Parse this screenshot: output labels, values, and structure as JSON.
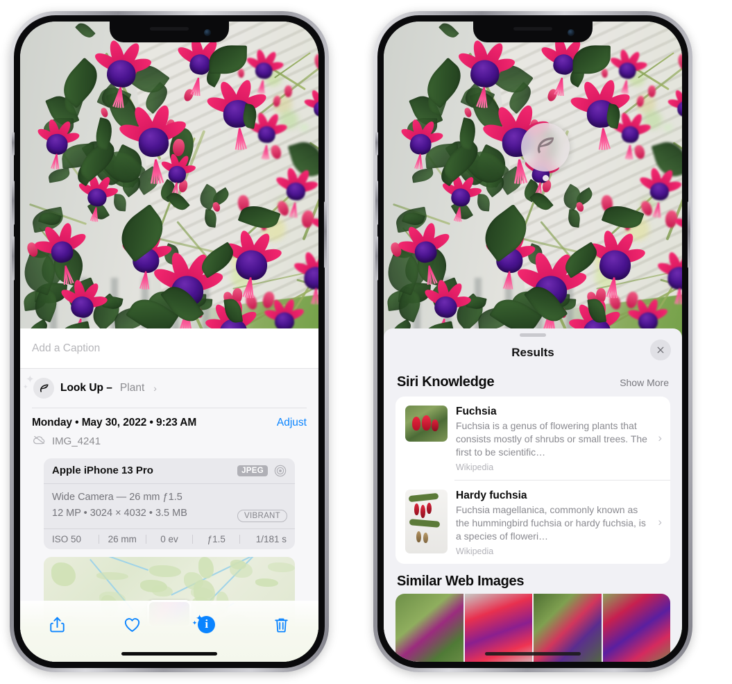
{
  "left_phone": {
    "photo": {
      "subject": "fuchsia-flowers-hanging-basket"
    },
    "caption_field": {
      "placeholder": "Add a Caption",
      "value": ""
    },
    "lookup": {
      "icon": "leaf-icon",
      "sparkle_icon": "sparkles-icon",
      "title": "Look Up –",
      "subject": "Plant",
      "chevron": "›"
    },
    "metadata": {
      "date": "Monday • May 30, 2022 • 9:23 AM",
      "adjust_label": "Adjust",
      "cloud_icon": "cloud-slash-icon",
      "filename": "IMG_4241"
    },
    "exif": {
      "device": "Apple iPhone 13 Pro",
      "format_badge": "JPEG",
      "aperture_icon": "aperture-icon",
      "lens_line": "Wide Camera — 26 mm ƒ1.5",
      "size_line": "12 MP • 3024 × 4032 • 3.5 MB",
      "style_badge": "VIBRANT",
      "stats": [
        "ISO 50",
        "26 mm",
        "0 ev",
        "ƒ1.5",
        "1/181 s"
      ]
    },
    "map": {
      "pin_label": "photo-location-pin"
    },
    "toolbar": [
      {
        "name": "share-button",
        "icon": "share-icon"
      },
      {
        "name": "favorite-button",
        "icon": "heart-icon"
      },
      {
        "name": "info-button",
        "icon": "info-sparkles-icon",
        "glyph": "i",
        "active": true
      },
      {
        "name": "delete-button",
        "icon": "trash-icon"
      }
    ]
  },
  "right_phone": {
    "photo": {
      "subject": "fuchsia-flowers-hanging-basket"
    },
    "badge": {
      "icon": "leaf-icon",
      "name": "visual-look-up-badge"
    },
    "sheet": {
      "grabber": "drag-handle",
      "title": "Results",
      "close_icon": "close-icon"
    },
    "siri_knowledge": {
      "title": "Siri Knowledge",
      "action": "Show More",
      "items": [
        {
          "title": "Fuchsia",
          "description": "Fuchsia is a genus of flowering plants that consists mostly of shrubs or small trees. The first to be scientific…",
          "source": "Wikipedia",
          "chevron": "›",
          "thumb": "fuchsia-red-flowers-thumb"
        },
        {
          "title": "Hardy fuchsia",
          "description": "Fuchsia magellanica, commonly known as the hummingbird fuchsia or hardy fuchsia, is a species of floweri…",
          "source": "Wikipedia",
          "chevron": "›",
          "thumb": "hardy-fuchsia-branch-thumb"
        }
      ]
    },
    "similar_web_images": {
      "title": "Similar Web Images",
      "thumbs": [
        "fuchsia-pink-white-bloom",
        "fuchsia-red-purple-closeup",
        "fuchsia-bush-buds",
        "fuchsia-purple-pink-double"
      ]
    }
  },
  "colors": {
    "accent_blue": "#0a84ff",
    "sheet_bg": "#f1f1f5",
    "card_bg": "#ffffff",
    "exif_card_bg": "#e9e9ed",
    "muted_text": "#8a8a90"
  }
}
